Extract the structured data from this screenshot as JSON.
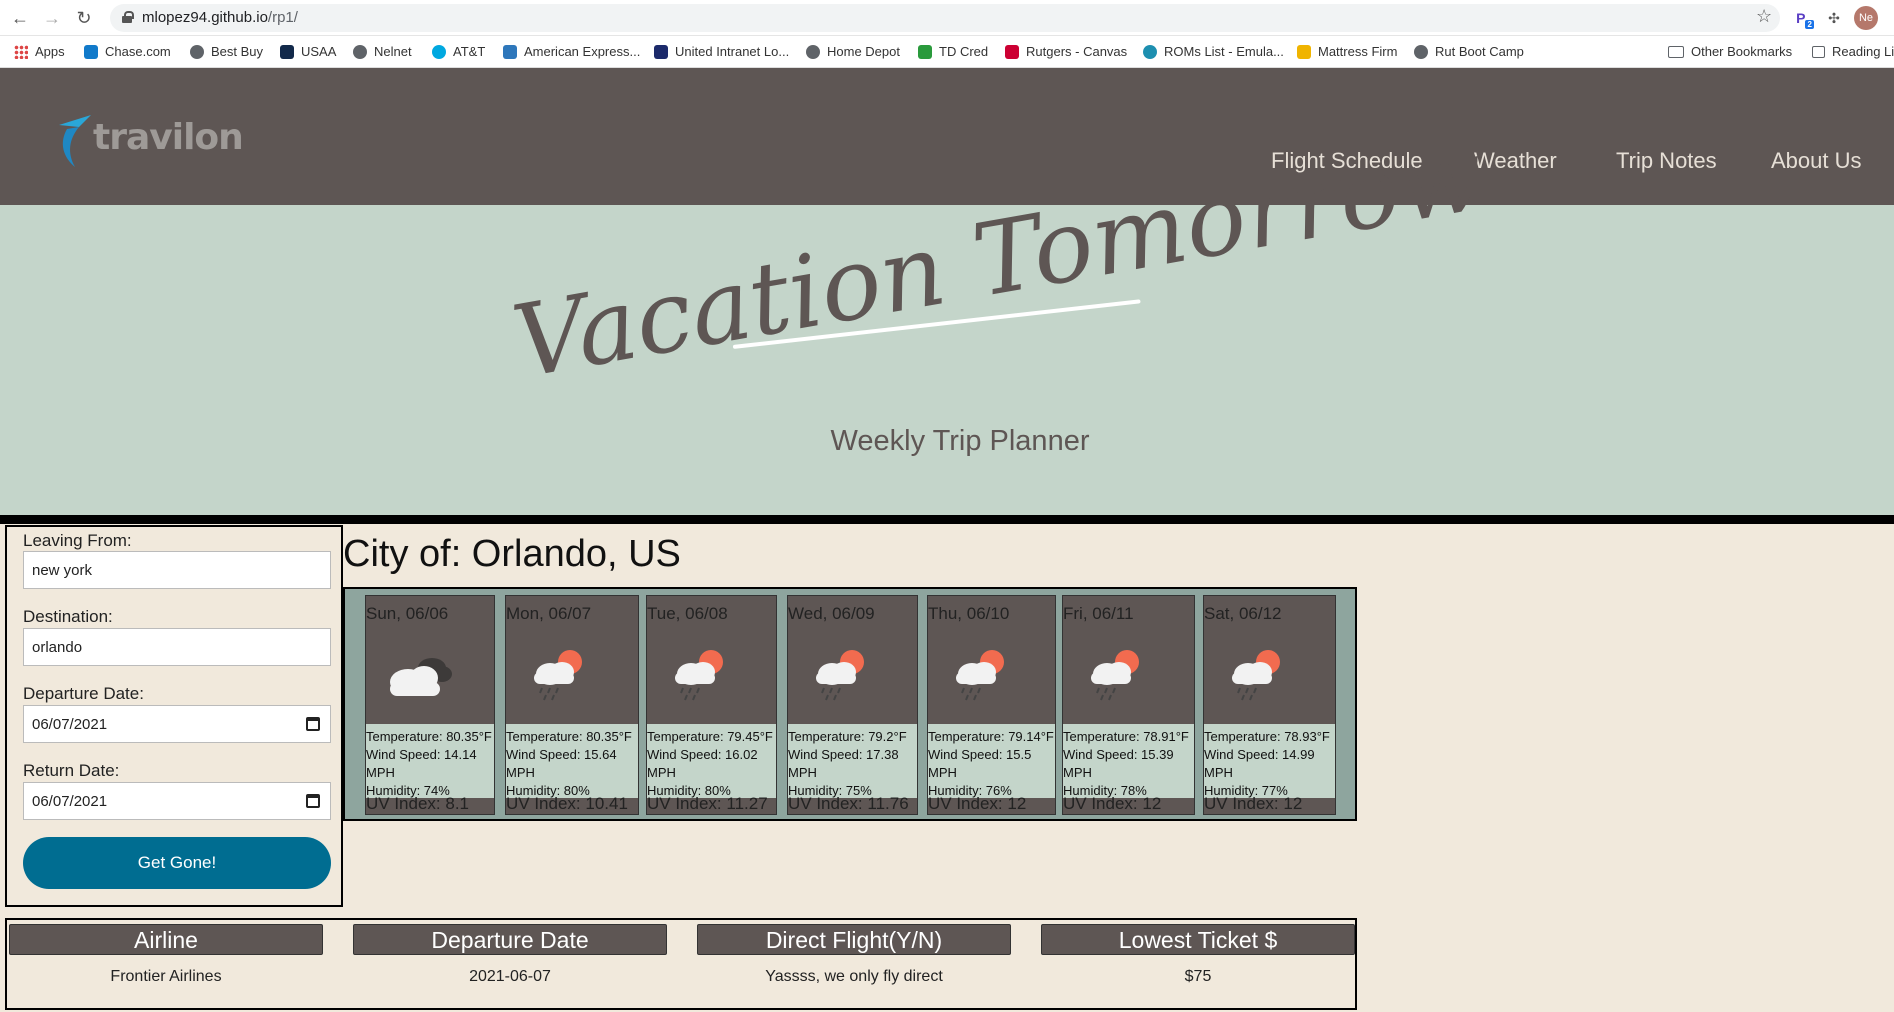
{
  "browser": {
    "url_host": "mlopez94.github.io",
    "url_path": "/rp1/",
    "profile_initials": "Ne",
    "extension_badge": "2",
    "bookmarks": [
      "Apps",
      "Chase.com",
      "Best Buy",
      "USAA",
      "Nelnet",
      "AT&T",
      "American Express...",
      "United Intranet Lo...",
      "Home Depot",
      "TD Cred",
      "Rutgers - Canvas",
      "ROMs List - Emula...",
      "Mattress Firm",
      "Rut Boot Camp"
    ],
    "other_bookmarks": "Other Bookmarks",
    "reading_list": "Reading Li"
  },
  "site": {
    "logo": "travilon",
    "nav": [
      "Flight Schedule",
      "Weather",
      "Trip Notes",
      "About Us"
    ],
    "hero_title": "Vacation Tomorrow",
    "hero_subtitle": "Weekly Trip Planner"
  },
  "form": {
    "leaving_label": "Leaving From:",
    "leaving_value": "new york",
    "destination_label": "Destination:",
    "destination_value": "orlando",
    "departure_label": "Departure Date:",
    "departure_value": "06/07/2021",
    "return_label": "Return Date:",
    "return_value": "06/07/2021",
    "submit_label": "Get Gone!"
  },
  "weather": {
    "city_title": "City of: Orlando, US",
    "days": [
      {
        "date": "Sun, 06/06",
        "icon": "cloudy-icon",
        "temp": "Temperature: 80.35°F",
        "wind": "Wind Speed: 14.14",
        "wind_unit": "MPH",
        "humidity": "Humidity: 74%",
        "uv": "UV Index: 8.1"
      },
      {
        "date": "Mon, 06/07",
        "icon": "rain-sun-icon",
        "temp": "Temperature: 80.35°F",
        "wind": "Wind Speed: 15.64",
        "wind_unit": "MPH",
        "humidity": "Humidity: 80%",
        "uv": "UV Index: 10.41"
      },
      {
        "date": "Tue, 06/08",
        "icon": "rain-sun-icon",
        "temp": "Temperature: 79.45°F",
        "wind": "Wind Speed: 16.02",
        "wind_unit": "MPH",
        "humidity": "Humidity: 80%",
        "uv": "UV Index: 11.27"
      },
      {
        "date": "Wed, 06/09",
        "icon": "rain-sun-icon",
        "temp": "Temperature: 79.2°F",
        "wind": "Wind Speed: 17.38",
        "wind_unit": "MPH",
        "humidity": "Humidity: 75%",
        "uv": "UV Index: 11.76"
      },
      {
        "date": "Thu, 06/10",
        "icon": "rain-sun-icon",
        "temp": "Temperature: 79.14°F",
        "wind": "Wind Speed: 15.5",
        "wind_unit": "MPH",
        "humidity": "Humidity: 76%",
        "uv": "UV Index: 12"
      },
      {
        "date": "Fri, 06/11",
        "icon": "rain-sun-icon",
        "temp": "Temperature: 78.91°F",
        "wind": "Wind Speed: 15.39",
        "wind_unit": "MPH",
        "humidity": "Humidity: 78%",
        "uv": "UV Index: 12"
      },
      {
        "date": "Sat, 06/12",
        "icon": "rain-sun-icon",
        "temp": "Temperature: 78.93°F",
        "wind": "Wind Speed: 14.99",
        "wind_unit": "MPH",
        "humidity": "Humidity: 77%",
        "uv": "UV Index: 12"
      }
    ]
  },
  "flights": {
    "headers": [
      "Airline",
      "Departure Date",
      "Direct Flight(Y/N)",
      "Lowest Ticket $"
    ],
    "row": [
      "Frontier Airlines",
      "2021-06-07",
      "Yassss, we only fly direct",
      "$75"
    ]
  },
  "colors": {
    "header_bg": "#5e5654",
    "hero_bg": "#c4d5ca",
    "page_bg": "#f1e9dc",
    "button": "#006d91",
    "forecast_bg": "#8ea59e"
  }
}
